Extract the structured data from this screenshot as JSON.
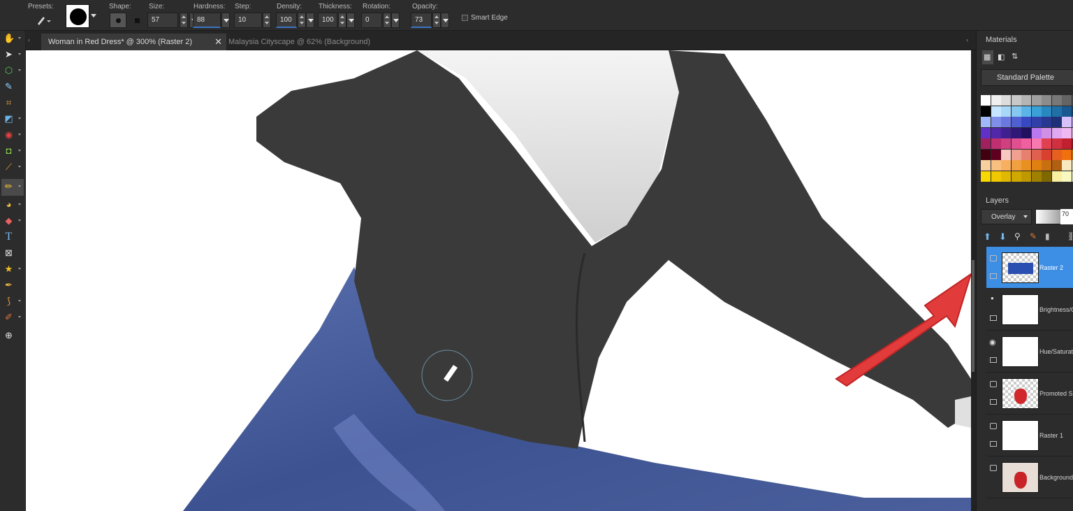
{
  "toolbar": {
    "presets_label": "Presets:",
    "shape_label": "Shape:",
    "size_label": "Size:",
    "size_value": "57",
    "hardness_label": "Hardness:",
    "hardness_value": "88",
    "step_label": "Step:",
    "step_value": "10",
    "density_label": "Density:",
    "density_value": "100",
    "thickness_label": "Thickness:",
    "thickness_value": "100",
    "rotation_label": "Rotation:",
    "rotation_value": "0",
    "opacity_label": "Opacity:",
    "opacity_value": "73",
    "smart_edge_label": "Smart Edge"
  },
  "tabs": [
    {
      "label": "Woman in Red Dress* @ 300% (Raster 2)"
    },
    {
      "label": "Malaysia Cityscape @  62% (Background)"
    }
  ],
  "materials": {
    "title": "Materials",
    "palette": "Standard Palette",
    "swatch_rows": [
      [
        "#ffffff",
        "#f0f0f0",
        "#dcdcdc",
        "#c8c8c8",
        "#b4b4b4",
        "#a0a0a0",
        "#8c8c8c",
        "#787878",
        "#646464",
        "#505050"
      ],
      [
        "#000000",
        "#c6e6ff",
        "#a8d8f8",
        "#86c8f0",
        "#5ab4e8",
        "#3aa0d8",
        "#2a88c0",
        "#2070a8",
        "#1a5890",
        "#124070"
      ],
      [
        "#a0b8f8",
        "#8090e8",
        "#6a78e0",
        "#5060d0",
        "#3848c0",
        "#3040a8",
        "#283890",
        "#203078",
        "#d8c0f8",
        "#c0a8f0"
      ],
      [
        "#6030c8",
        "#5028a8",
        "#402090",
        "#301878",
        "#201060",
        "#b878f0",
        "#d090e8",
        "#e0a8f0",
        "#f0b8f0",
        "#f8c8f8"
      ],
      [
        "#a02060",
        "#c03070",
        "#d04080",
        "#e05090",
        "#f060a0",
        "#f878b0",
        "#e04050",
        "#d03040",
        "#c02030",
        "#b01020"
      ],
      [
        "#400010",
        "#600020",
        "#f8c8c0",
        "#f0a090",
        "#e88070",
        "#e06050",
        "#d84030",
        "#e86020",
        "#f07010",
        "#f88000"
      ],
      [
        "#f8d0a0",
        "#f8c080",
        "#f8b060",
        "#f0a040",
        "#e89020",
        "#e08010",
        "#c87010",
        "#b06010",
        "#f8e8c0",
        "#f8f0d0"
      ],
      [
        "#f8d800",
        "#f0c800",
        "#e0b800",
        "#d0a800",
        "#c09800",
        "#a08000",
        "#806800",
        "#f8f0a0",
        "#f8f8c0",
        "#ffffe0"
      ]
    ]
  },
  "layers": {
    "title": "Layers",
    "blend_mode": "Overlay",
    "opacity_value": "70",
    "items": [
      {
        "name": "Raster 2"
      },
      {
        "name": "Brightness/C"
      },
      {
        "name": "Hue/Saturati"
      },
      {
        "name": "Promoted S"
      },
      {
        "name": "Raster 1"
      },
      {
        "name": "Background"
      }
    ]
  },
  "colors": {
    "accent": "#3d8fe6",
    "annotation_arrow": "#e23b3b",
    "skirt": "#4a5f9c"
  }
}
